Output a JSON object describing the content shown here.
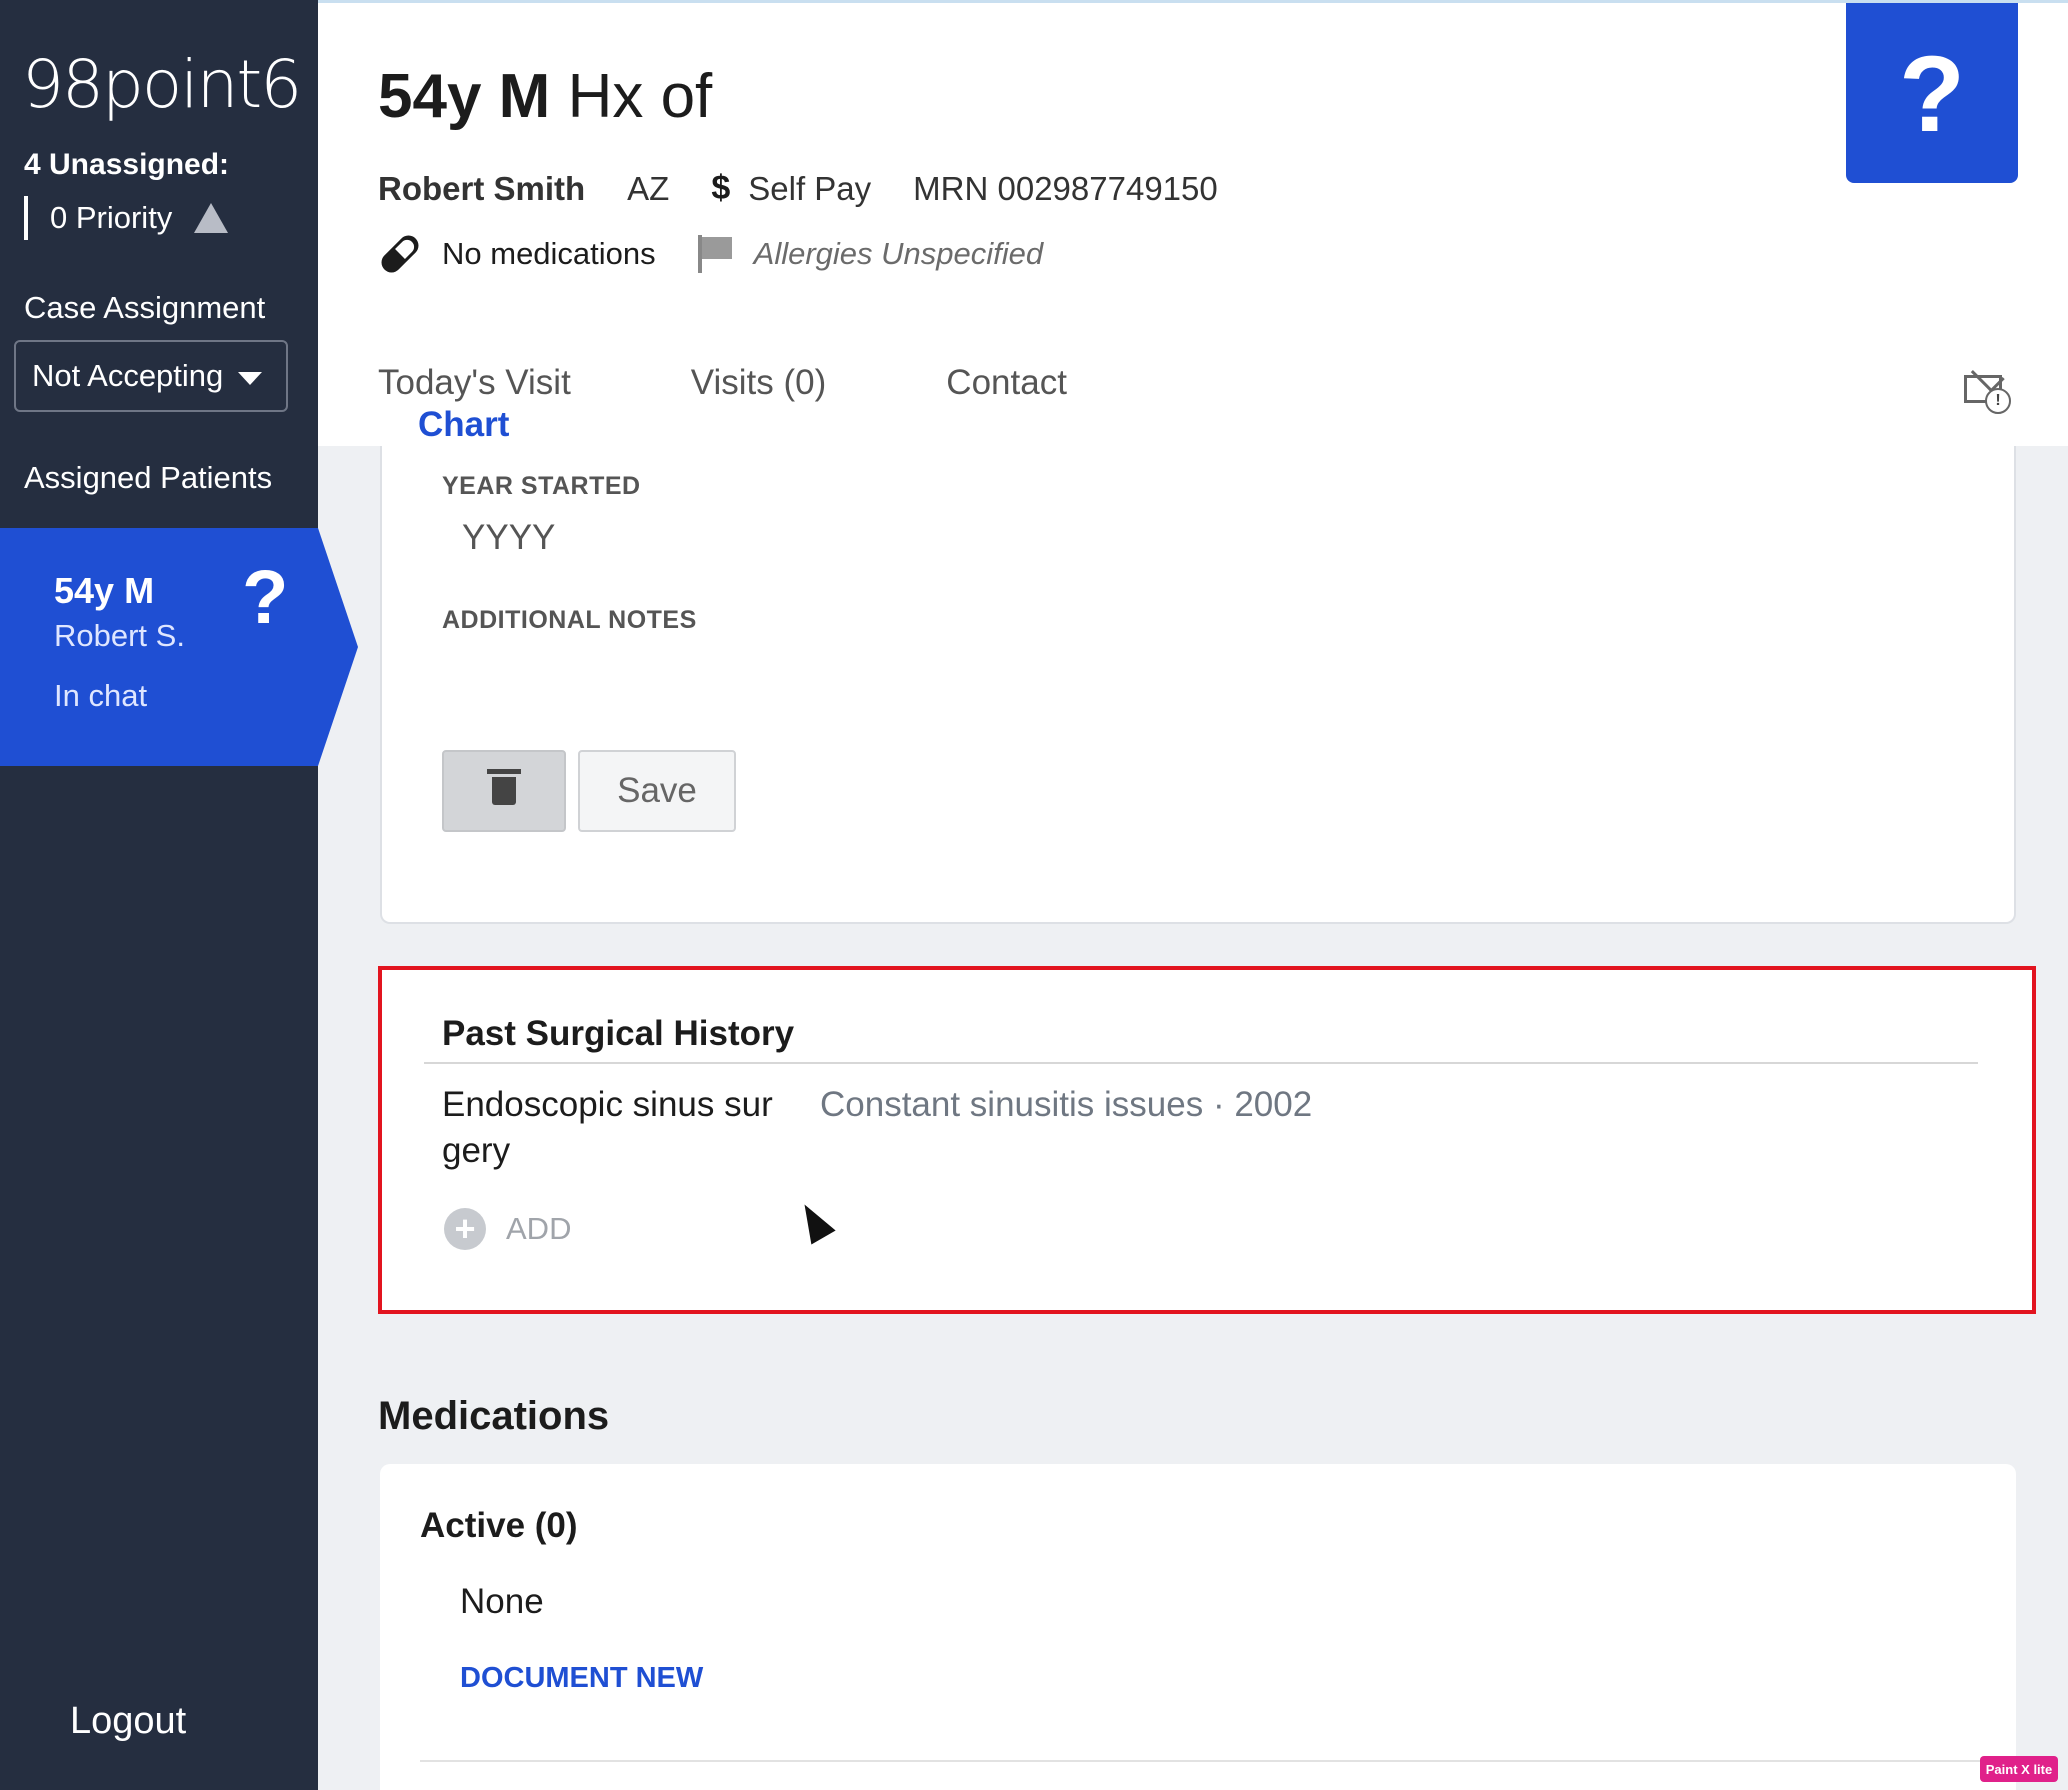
{
  "sidebar": {
    "logo": "98point6",
    "unassigned": "4 Unassigned:",
    "priority": "0 Priority",
    "case_assignment_label": "Case Assignment",
    "case_assignment_value": "Not Accepting",
    "assigned_patients_label": "Assigned Patients",
    "patient": {
      "age_sex": "54y M",
      "name": "Robert S.",
      "status": "In chat",
      "status_icon": "?"
    },
    "logout": "Logout"
  },
  "header": {
    "title_bold": "54y M",
    "title_rest": "Hx of",
    "patient_name": "Robert Smith",
    "state": "AZ",
    "pay_icon": "$",
    "payment": "Self Pay",
    "mrn": "MRN 002987749150",
    "medications": "No medications",
    "allergies": "Allergies Unspecified",
    "help_symbol": "?"
  },
  "tabs": [
    {
      "label": "Today's Visit"
    },
    {
      "label": "Chart"
    },
    {
      "label": "Visits (0)"
    },
    {
      "label": "Contact"
    }
  ],
  "form": {
    "year_started_label": "YEAR STARTED",
    "year_placeholder": "YYYY",
    "additional_notes_label": "ADDITIONAL NOTES",
    "save_label": "Save"
  },
  "surgical_history": {
    "title": "Past Surgical History",
    "items": [
      {
        "name": "Endoscopic sinus surgery",
        "detail": "Constant sinusitis issues · 2002"
      }
    ],
    "add_label": "ADD"
  },
  "medications": {
    "title": "Medications",
    "active_label": "Active (0)",
    "none_label": "None",
    "document_new": "DOCUMENT NEW"
  },
  "badge": "Paint X lite",
  "colors": {
    "accent": "#1f4fd3",
    "sidebar": "#252e40",
    "highlight": "#e2141f"
  }
}
